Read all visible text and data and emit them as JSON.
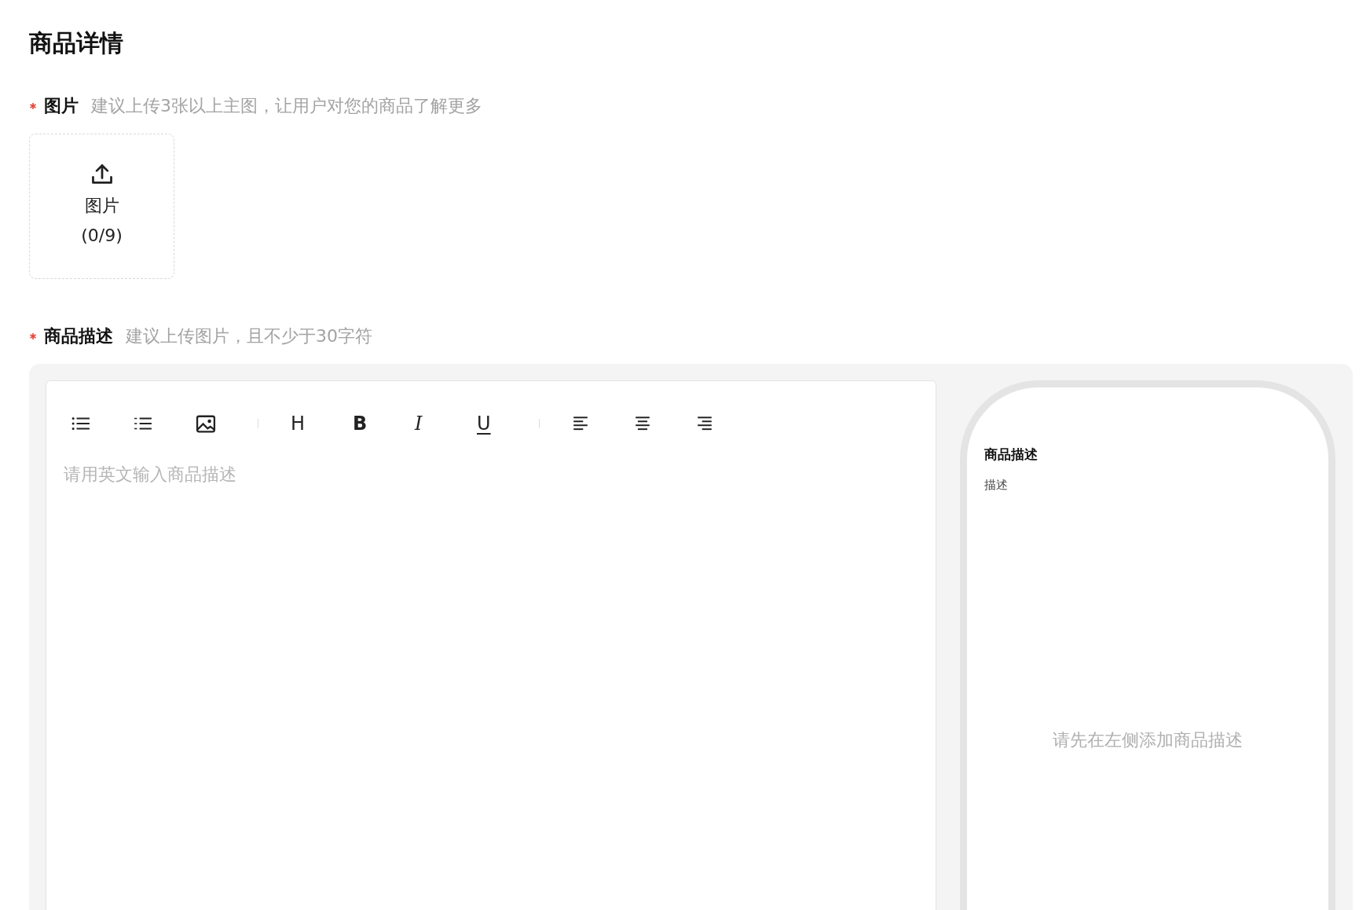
{
  "page_title": "商品详情",
  "images_field": {
    "label": "图片",
    "required": true,
    "hint": "建议上传3张以上主图，让用户对您的商品了解更多",
    "upload": {
      "label": "图片",
      "count": "(0/9)"
    }
  },
  "description_field": {
    "label": "商品描述",
    "required": true,
    "hint": "建议上传图片，且不少于30字符"
  },
  "editor": {
    "toolbar": [
      {
        "kind": "bullet-list"
      },
      {
        "kind": "numbered-list"
      },
      {
        "kind": "image"
      },
      {
        "kind": "divider"
      },
      {
        "kind": "heading",
        "label": "H"
      },
      {
        "kind": "bold",
        "label": "B"
      },
      {
        "kind": "italic",
        "label": "I"
      },
      {
        "kind": "underline",
        "label": "U"
      },
      {
        "kind": "divider"
      },
      {
        "kind": "align-left"
      },
      {
        "kind": "align-center"
      },
      {
        "kind": "align-right"
      }
    ],
    "placeholder": "请用英文输入商品描述"
  },
  "preview": {
    "title": "商品描述",
    "subtitle": "描述",
    "empty_text": "请先在左侧添加商品描述"
  }
}
